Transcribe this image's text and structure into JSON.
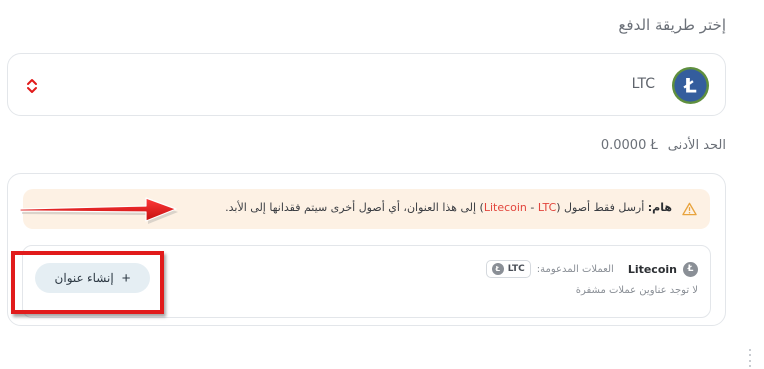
{
  "section_title": "إختر طريقة الدفع",
  "currency_select": {
    "code": "LTC",
    "logo_letter": "Ł"
  },
  "minimum": {
    "label": "الحد الأدنى",
    "value": "0.0000 Ł"
  },
  "warning": {
    "bold": "هام:",
    "text_before": " أرسل فقط أصول (",
    "coin_full": "Litecoin",
    "dash": " - ",
    "coin_code": "LTC",
    "text_after": ") إلى هذا العنوان، أي أصول أخرى سيتم فقدانها إلى الأبد."
  },
  "address_card": {
    "coin_name": "Litecoin",
    "supported_label": "العملات المدعومة:",
    "chip_code": "LTC",
    "empty_text": "لا توجد عناوين عملات مشفرة",
    "create_button": {
      "icon": "+",
      "label": "إنشاء عنوان"
    }
  },
  "colors": {
    "annotation": "#e11b1b",
    "litecoin_blue": "#345d9d",
    "warning_bg": "#fdf1e4",
    "button_bg": "#e5eef3"
  },
  "icons": [
    "litecoin-logo",
    "chevron-updown-icon",
    "warning-triangle-icon",
    "plus-icon",
    "annotation-arrow"
  ]
}
